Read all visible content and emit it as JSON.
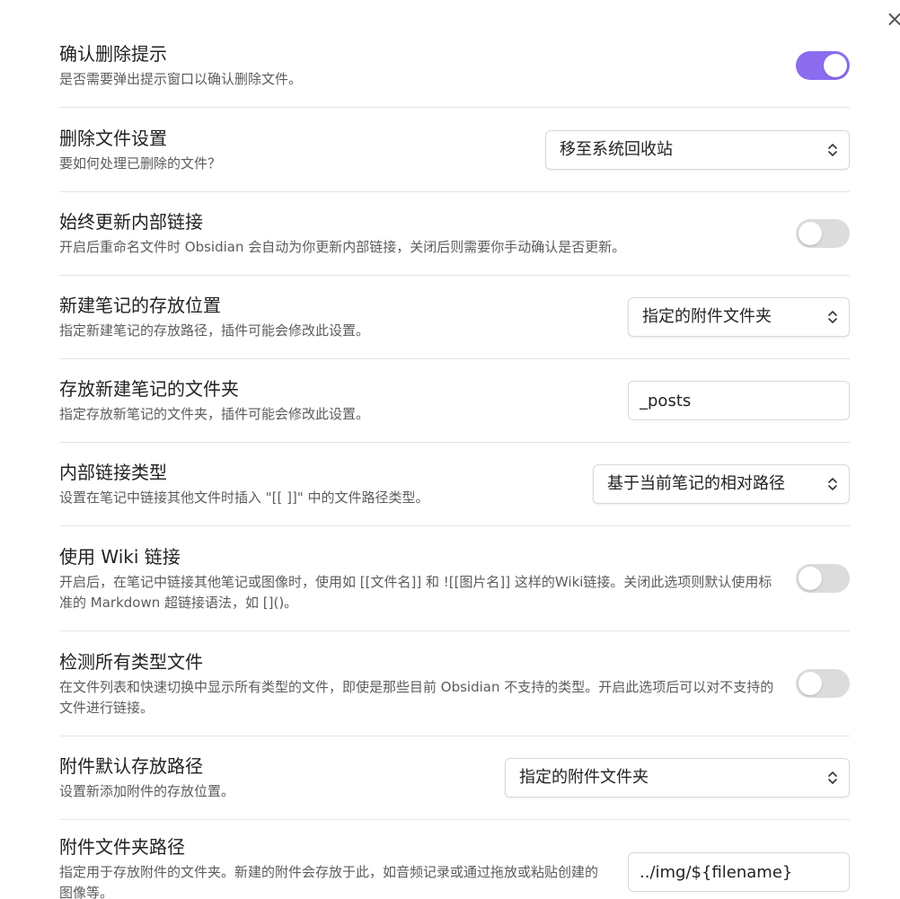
{
  "close_icon": "×",
  "colors": {
    "accent": "#8b6cef",
    "toggle_off": "#dcdcdc",
    "divider": "#e4e4e4"
  },
  "settings": [
    {
      "title": "确认删除提示",
      "desc": "是否需要弹出提示窗口以确认删除文件。",
      "control": "toggle",
      "on": true
    },
    {
      "title": "删除文件设置",
      "desc": "要如何处理已删除的文件？",
      "control": "dropdown",
      "value": "移至系统回收站"
    },
    {
      "title": "始终更新内部链接",
      "desc": "开启后重命名文件时 Obsidian 会自动为你更新内部链接，关闭后则需要你手动确认是否更新。",
      "control": "toggle",
      "on": false
    },
    {
      "title": "新建笔记的存放位置",
      "desc": "指定新建笔记的存放路径，插件可能会修改此设置。",
      "control": "dropdown",
      "value": "指定的附件文件夹"
    },
    {
      "title": "存放新建笔记的文件夹",
      "desc": "指定存放新笔记的文件夹，插件可能会修改此设置。",
      "control": "text",
      "value": "_posts"
    },
    {
      "title": "内部链接类型",
      "desc": "设置在笔记中链接其他文件时插入 \"[[ ]]\" 中的文件路径类型。",
      "control": "dropdown",
      "value": "基于当前笔记的相对路径"
    },
    {
      "title": "使用 Wiki 链接",
      "desc": "开启后，在笔记中链接其他笔记或图像时，使用如 [[文件名]] 和 ![[图片名]] 这样的Wiki链接。关闭此选项则默认使用标准的 Markdown 超链接语法，如 []()。",
      "control": "toggle",
      "on": false
    },
    {
      "title": "检测所有类型文件",
      "desc": "在文件列表和快速切换中显示所有类型的文件，即使是那些目前 Obsidian 不支持的类型。开启此选项后可以对不支持的文件进行链接。",
      "control": "toggle",
      "on": false
    },
    {
      "title": "附件默认存放路径",
      "desc": "设置新添加附件的存放位置。",
      "control": "dropdown",
      "value": "指定的附件文件夹"
    },
    {
      "title": "附件文件夹路径",
      "desc": "指定用于存放附件的文件夹。新建的附件会存放于此，如音频记录或通过拖放或粘贴创建的图像等。",
      "control": "text",
      "value": "../img/${filename}"
    }
  ]
}
